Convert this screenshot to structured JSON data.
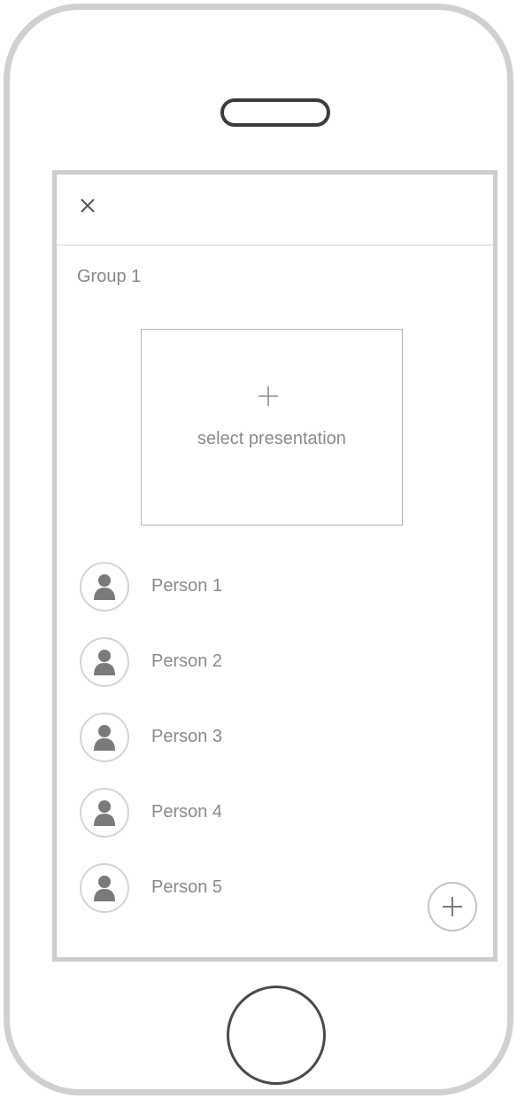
{
  "device": {
    "frame_color": "#d0d0d0",
    "screen_border_color": "#cdcdcd"
  },
  "header": {
    "close_icon": "close-icon"
  },
  "group": {
    "title": "Group 1"
  },
  "presentation": {
    "icon": "plus-icon",
    "label": "select presentation"
  },
  "people": [
    {
      "name": "Person 1",
      "icon": "person-icon"
    },
    {
      "name": "Person 2",
      "icon": "person-icon"
    },
    {
      "name": "Person 3",
      "icon": "person-icon"
    },
    {
      "name": "Person 4",
      "icon": "person-icon"
    },
    {
      "name": "Person 5",
      "icon": "person-icon"
    }
  ],
  "fab": {
    "icon": "plus-icon"
  },
  "colors": {
    "text": "#8a8a8a",
    "avatar_icon": "#7a7a7a"
  }
}
